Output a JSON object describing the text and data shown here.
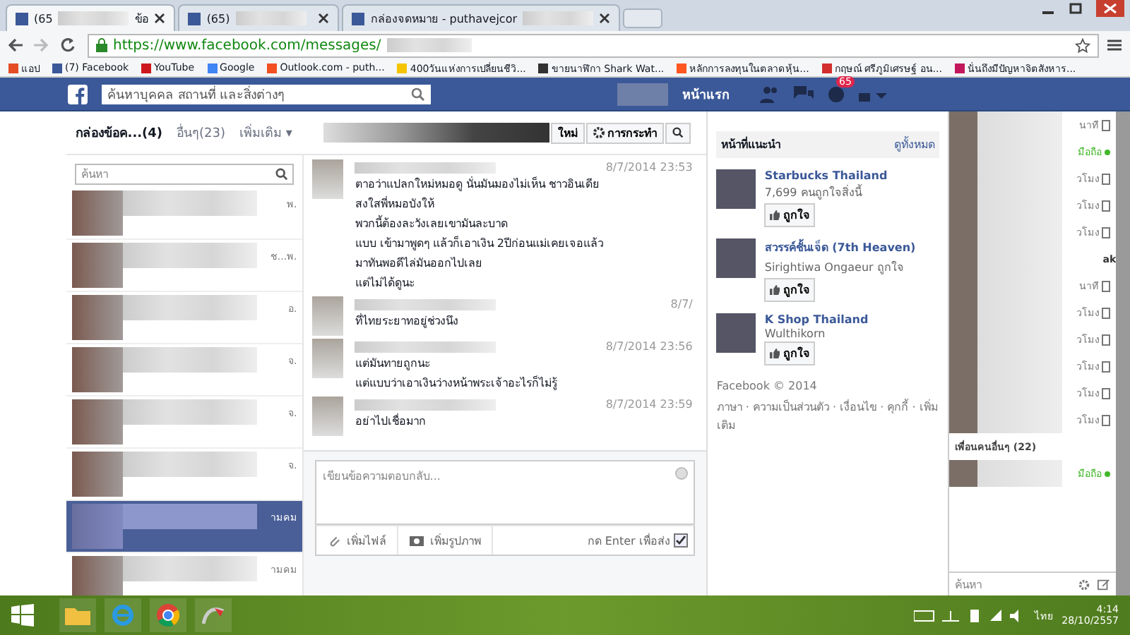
{
  "browser": {
    "tabs": [
      {
        "label": "(65",
        "extra": "ข้อ",
        "selected": true
      },
      {
        "label": "(65)",
        "selected": false
      },
      {
        "label": "กล่องจดหมาย - puthavejcor",
        "selected": false
      }
    ],
    "url": "https://www.facebook.com/messages/",
    "bookmarks": [
      {
        "label": "แอป",
        "color": "#e44d26"
      },
      {
        "label": "(7) Facebook",
        "color": "#3b5998"
      },
      {
        "label": "YouTube",
        "color": "#cc181e"
      },
      {
        "label": "Google",
        "color": "#4285f4"
      },
      {
        "label": "Outlook.com - puth...",
        "color": "#f25022"
      },
      {
        "label": "400วันแห่งการเปลี่ยนชีวิ...",
        "color": "#f5c400"
      },
      {
        "label": "ขายนาฬิกา Shark Wat...",
        "color": "#333333"
      },
      {
        "label": "หลักการลงทุนในตลาดหุ้น...",
        "color": "#ff5722"
      },
      {
        "label": "กฤษณ์ ศรีภูมิเศรษฐ์ อน...",
        "color": "#d32f2f"
      },
      {
        "label": "นั่นถึงมีปัญหาจิตสังหาร...",
        "color": "#c2185b"
      }
    ]
  },
  "fb_header": {
    "search_placeholder": "ค้นหาบุคคล สถานที่ และสิ่งต่างๆ",
    "home": "หน้าแรก",
    "badge": "65"
  },
  "messages": {
    "folders": [
      {
        "label": "กล่องข้อค...",
        "count": "(4)",
        "selected": true
      },
      {
        "label": "อื่นๆ",
        "count": "(23)",
        "selected": false
      }
    ],
    "more": "เพิ่มเติม ▾",
    "new_button": "ใหม่",
    "actions_button": "การกระทำ",
    "search_placeholder": "ค้นหา",
    "conversations": [
      {
        "time": "พ.",
        "selected": false
      },
      {
        "time": "ช...พ.",
        "selected": false
      },
      {
        "time": "อ.",
        "selected": false
      },
      {
        "time": "จ.",
        "selected": false
      },
      {
        "time": "จ.",
        "selected": false
      },
      {
        "time": "จ.",
        "selected": false
      },
      {
        "time": "ามคม",
        "selected": true
      },
      {
        "time": "ามคม",
        "selected": false
      }
    ],
    "thread": [
      {
        "time": "8/7/2014 23:53",
        "lines": [
          "ตาอว่าแปลกใหม่หมอดู นั่นมันมองไม่เห็น ชาวอินเดีย",
          "สงใสพี่หมอบังให้",
          "พวกนี้ต้องละวังเลยเขามันละบาด",
          "แบบ เข้ามาพูดๆ แล้วก็เอาเงิน 2ปีก่อนแม่เคยเจอแล้ว",
          "มาทันพอดีไล่มันออกไปเลย",
          "แต่ไม่ได้ดูนะ"
        ]
      },
      {
        "time": "8/7/",
        "lines": [
          "ที่ไทยระยาทอยู่ช่วงนึง"
        ]
      },
      {
        "time": "8/7/2014 23:56",
        "lines": [
          "แต่มันทายถูกนะ",
          "แต่แบบว่าเอาเงินว่างหน้าพระเจ้าอะไรก็ไม่รู้"
        ]
      },
      {
        "time": "8/7/2014 23:59",
        "lines": [
          "อย่าไปเชื่อมาก"
        ]
      }
    ],
    "composer": {
      "placeholder": "เขียนข้อความตอบกลับ...",
      "attach": "เพิ่มไฟล์",
      "photo": "เพิ่มรูปภาพ",
      "enter_label": "กด Enter เพื่อส่ง",
      "enter_checked": true
    }
  },
  "suggested": {
    "title": "หน้าที่แนะนำ",
    "see_all": "ดูทั้งหมด",
    "pages": [
      {
        "name": "Starbucks Thailand",
        "meta": "7,699 คนถูกใจสิ่งนี้",
        "like": "ถูกใจ"
      },
      {
        "name": "สวรรค์ชั้นเจ็ด (7th Heaven)",
        "meta": "Sirightiwa Ongaeur ถูกใจ",
        "like": "ถูกใจ"
      },
      {
        "name": "K Shop Thailand",
        "meta": "Wulthikorn",
        "like": "ถูกใจ"
      }
    ],
    "footer": "Facebook © 2014",
    "links": "ภาษา · ความเป็นส่วนตัว · เงื่อนไข · คุกกี้ · เพิ่มเติม"
  },
  "chat": {
    "rows": [
      {
        "kind": "time",
        "text": "นาที"
      },
      {
        "kind": "mobile",
        "text": "มือถือ"
      },
      {
        "kind": "time",
        "text": "วโมง"
      },
      {
        "kind": "time",
        "text": "วโมง"
      },
      {
        "kind": "time",
        "text": "วโมง"
      },
      {
        "kind": "name",
        "text": "ak"
      },
      {
        "kind": "time",
        "text": "นาที"
      },
      {
        "kind": "time",
        "text": "วโมง"
      },
      {
        "kind": "time",
        "text": "วโมง"
      },
      {
        "kind": "time",
        "text": "วโมง"
      },
      {
        "kind": "time",
        "text": "วโมง"
      },
      {
        "kind": "time",
        "text": "วโมง"
      },
      {
        "kind": "section",
        "text": "เพื่อนคนอื่นๆ (22)"
      },
      {
        "kind": "mobile",
        "text": "มือถือ"
      }
    ],
    "search_placeholder": "ค้นหา"
  },
  "taskbar": {
    "language": "ไทย",
    "time": "4:14",
    "date": "28/10/2557"
  }
}
